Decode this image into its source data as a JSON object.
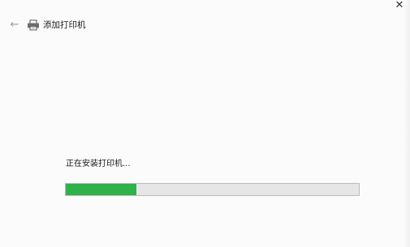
{
  "header": {
    "back_icon": "arrow-left-icon",
    "printer_icon": "printer-icon",
    "title": "添加打印机",
    "close_icon": "close-icon"
  },
  "main": {
    "status_text": "正在安装打印机...",
    "progress_fraction": 0.24,
    "progress_color": "#2fb24a"
  }
}
